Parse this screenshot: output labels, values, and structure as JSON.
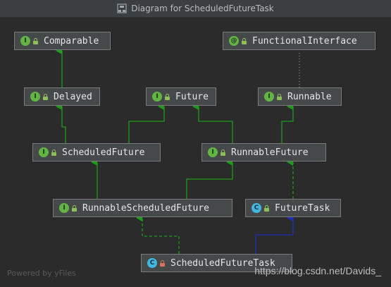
{
  "window": {
    "title": "Diagram for ScheduledFutureTask"
  },
  "nodes": {
    "comparable": {
      "name": "Comparable",
      "kind": "I"
    },
    "functional_interface": {
      "name": "FunctionalInterface",
      "kind": "@"
    },
    "delayed": {
      "name": "Delayed",
      "kind": "I"
    },
    "future": {
      "name": "Future",
      "kind": "I"
    },
    "runnable": {
      "name": "Runnable",
      "kind": "I"
    },
    "scheduled_future": {
      "name": "ScheduledFuture",
      "kind": "I"
    },
    "runnable_future": {
      "name": "RunnableFuture",
      "kind": "I"
    },
    "runnable_scheduled_future": {
      "name": "RunnableScheduledFuture",
      "kind": "I"
    },
    "future_task": {
      "name": "FutureTask",
      "kind": "C"
    },
    "scheduled_future_task": {
      "name": "ScheduledFutureTask",
      "kind": "C"
    }
  },
  "footer": {
    "powered_by": "Powered by yFiles"
  },
  "watermark": "https://blog.csdn.net/Davids_",
  "colors": {
    "background": "#2b2b2b",
    "node_fill": "#45494a",
    "node_border": "#7a7a7a",
    "extends_edge": "#1f9a1f",
    "implements_class_edge": "#1f2fb8",
    "interface_badge": "#62b543",
    "class_badge": "#40b6e0"
  }
}
